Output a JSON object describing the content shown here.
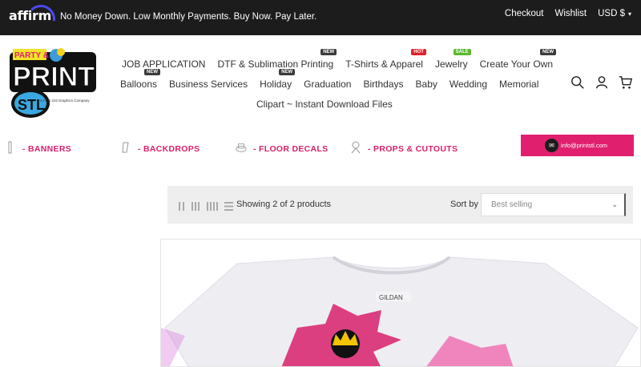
{
  "topbar": {
    "logo_text": "affirm",
    "promo": "No Money Down. Low Monthly Payments. Buy Now. Pay Later.",
    "checkout": "Checkout",
    "wishlist": "Wishlist",
    "currency": "USD $"
  },
  "logo": {
    "top": "PARTY &",
    "main": "PRINT",
    "sub": "STL",
    "tagline": "A Fit & Grit Graphics Company"
  },
  "nav": {
    "row1": [
      {
        "label": "JOB APPLICATION",
        "badge": ""
      },
      {
        "label": "DTF & Sublimation Printing",
        "badge": "NEW"
      },
      {
        "label": "T-Shirts & Apparel",
        "badge": "HOT"
      },
      {
        "label": "Jewelry",
        "badge": "SALE"
      },
      {
        "label": "Create Your Own",
        "badge": "NEW"
      }
    ],
    "row2": [
      {
        "label": "Balloons",
        "badge": "NEW"
      },
      {
        "label": "Business Services",
        "badge": ""
      },
      {
        "label": "Holiday",
        "badge": "NEW"
      },
      {
        "label": "Graduation",
        "badge": ""
      },
      {
        "label": "Birthdays",
        "badge": ""
      },
      {
        "label": "Baby",
        "badge": ""
      },
      {
        "label": "Wedding",
        "badge": ""
      },
      {
        "label": "Memorial",
        "badge": ""
      }
    ],
    "row3": [
      {
        "label": "Clipart ~ Instant Download Files",
        "badge": ""
      }
    ]
  },
  "categories": [
    "- BANNERS",
    "- BACKDROPS",
    "- FLOOR DECALS",
    "- PROPS & CUTOUTS"
  ],
  "email": "info@printstl.com",
  "toolbar": {
    "count": "Showing 2 of 2 products",
    "sort_label": "Sort by",
    "sort_value": "Best selling"
  },
  "product": {
    "tag_text": "GILDAN"
  },
  "colors": {
    "accent": "#e0206f",
    "topbar": "#1c1c1c",
    "category_text": "#d8206c"
  }
}
